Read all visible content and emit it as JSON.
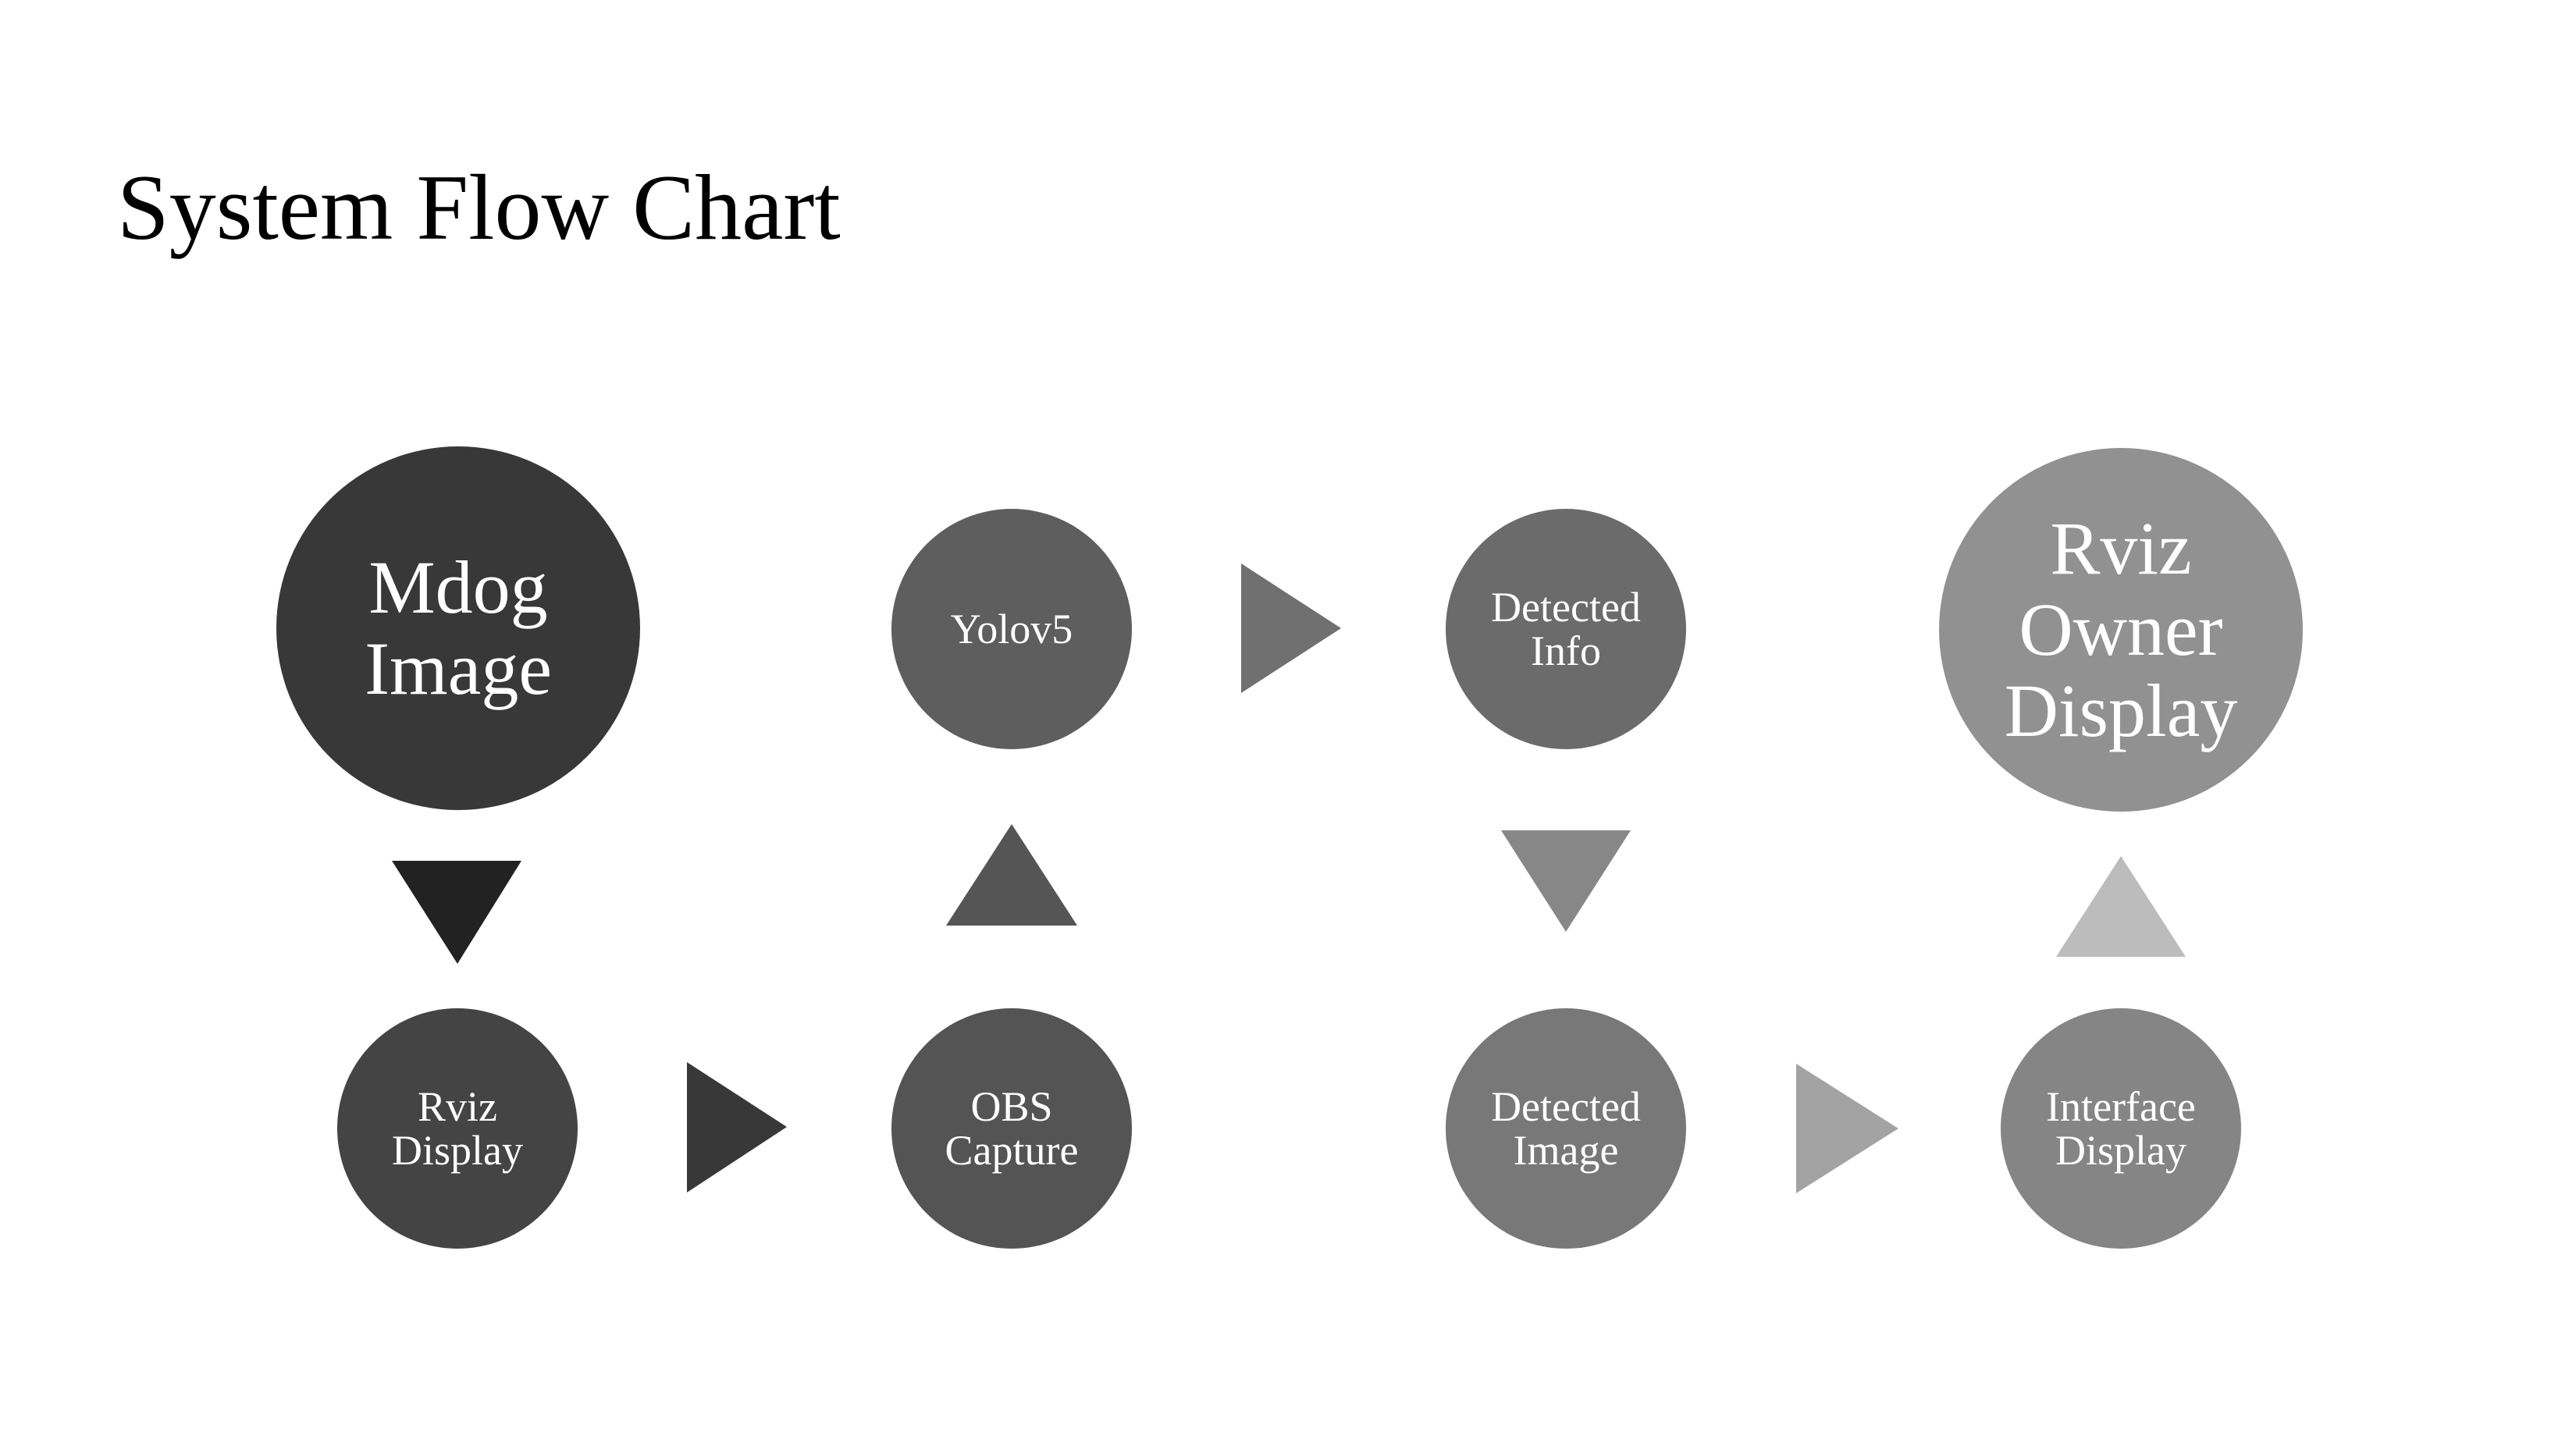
{
  "title": "System Flow Chart",
  "nodes": [
    {
      "id": "mdog-image",
      "lines": [
        "Mdog",
        "Image"
      ],
      "color": "#383838"
    },
    {
      "id": "rviz-display",
      "lines": [
        "Rviz",
        "Display"
      ],
      "color": "#444444"
    },
    {
      "id": "obs-capture",
      "lines": [
        "OBS",
        "Capture"
      ],
      "color": "#545454"
    },
    {
      "id": "yolov5",
      "lines": [
        "Yolov5"
      ],
      "color": "#5e5e5e"
    },
    {
      "id": "detected-info",
      "lines": [
        "Detected",
        "Info"
      ],
      "color": "#6b6b6b"
    },
    {
      "id": "detected-image",
      "lines": [
        "Detected",
        "Image"
      ],
      "color": "#787878"
    },
    {
      "id": "interface-display",
      "lines": [
        "Interface",
        "Display"
      ],
      "color": "#858585"
    },
    {
      "id": "rviz-owner-display",
      "lines": [
        "Rviz",
        "Owner",
        "Display"
      ],
      "color": "#919191"
    }
  ],
  "edges": [
    {
      "from": "mdog-image",
      "to": "rviz-display",
      "direction": "down",
      "color": "#222222"
    },
    {
      "from": "rviz-display",
      "to": "obs-capture",
      "direction": "right",
      "color": "#383838"
    },
    {
      "from": "obs-capture",
      "to": "yolov5",
      "direction": "up",
      "color": "#555555"
    },
    {
      "from": "yolov5",
      "to": "detected-info",
      "direction": "right",
      "color": "#707070"
    },
    {
      "from": "detected-info",
      "to": "detected-image",
      "direction": "down",
      "color": "#878787"
    },
    {
      "from": "detected-image",
      "to": "interface-display",
      "direction": "right",
      "color": "#a3a3a3"
    },
    {
      "from": "interface-display",
      "to": "rviz-owner-display",
      "direction": "up",
      "color": "#bcbcbc"
    }
  ]
}
